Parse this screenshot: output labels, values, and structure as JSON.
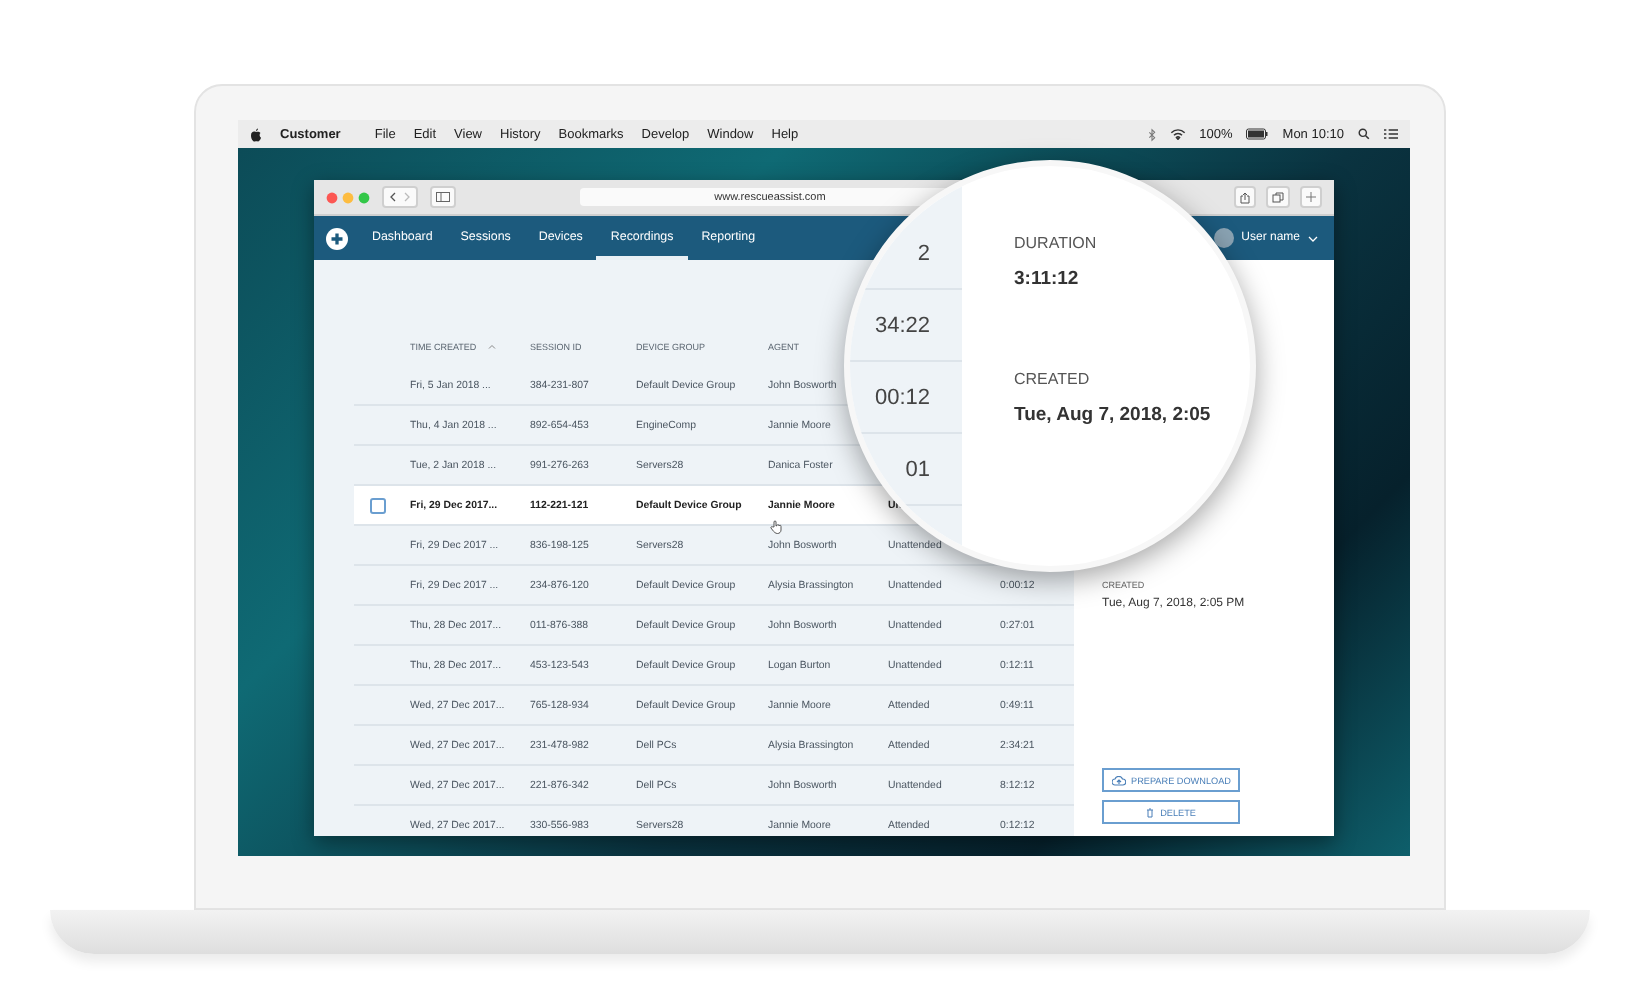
{
  "menubar": {
    "app": "Customer",
    "menus": [
      "File",
      "Edit",
      "View",
      "History",
      "Bookmarks",
      "Develop",
      "Window",
      "Help"
    ],
    "battery": "100%",
    "clock": "Mon 10:10"
  },
  "browser": {
    "url": "www.rescueassist.com"
  },
  "nav": {
    "tabs": [
      {
        "label": "Dashboard",
        "selected": false
      },
      {
        "label": "Sessions",
        "selected": false
      },
      {
        "label": "Devices",
        "selected": false
      },
      {
        "label": "Recordings",
        "selected": true
      },
      {
        "label": "Reporting",
        "selected": false
      }
    ],
    "user": "User name"
  },
  "table": {
    "columns": [
      "TIME CREATED",
      "SESSION ID",
      "DEVICE GROUP",
      "AGENT"
    ],
    "rows": [
      {
        "time": "Fri, 5 Jan 2018 ...",
        "session": "384-231-807",
        "group": "Default Device Group",
        "agent": "John Bosworth",
        "selected": false
      },
      {
        "time": "Thu, 4 Jan 2018 ...",
        "session": "892-654-453",
        "group": "EngineComp",
        "agent": "Jannie Moore",
        "selected": false
      },
      {
        "time": "Tue, 2 Jan 2018 ...",
        "session": "991-276-263",
        "group": "Servers28",
        "agent": "Danica Foster",
        "selected": false
      },
      {
        "time": "Fri, 29 Dec 2017...",
        "session": "112-221-121",
        "group": "Default Device Group",
        "agent": "Jannie Moore",
        "type": "Un",
        "selected": true
      },
      {
        "time": "Fri, 29 Dec 2017 ...",
        "session": "836-198-125",
        "group": "Servers28",
        "agent": "John Bosworth",
        "type": "Unattended",
        "selected": false
      },
      {
        "time": "Fri, 29 Dec 2017 ...",
        "session": "234-876-120",
        "group": "Default Device Group",
        "agent": "Alysia Brassington",
        "type": "Unattended",
        "duration": "0:00:12",
        "selected": false
      },
      {
        "time": "Thu, 28 Dec 2017...",
        "session": "011-876-388",
        "group": "Default Device Group",
        "agent": "John Bosworth",
        "type": "Unattended",
        "duration": "0:27:01",
        "selected": false
      },
      {
        "time": "Thu, 28 Dec 2017...",
        "session": "453-123-543",
        "group": "Default Device Group",
        "agent": "Logan Burton",
        "type": "Unattended",
        "duration": "0:12:11",
        "selected": false
      },
      {
        "time": "Wed, 27 Dec 2017...",
        "session": "765-128-934",
        "group": "Default Device Group",
        "agent": "Jannie Moore",
        "type": "Attended",
        "duration": "0:49:11",
        "selected": false
      },
      {
        "time": "Wed, 27 Dec 2017...",
        "session": "231-478-982",
        "group": "Dell PCs",
        "agent": "Alysia Brassington",
        "type": "Attended",
        "duration": "2:34:21",
        "selected": false
      },
      {
        "time": "Wed, 27 Dec 2017...",
        "session": "221-876-342",
        "group": "Dell PCs",
        "agent": "John Bosworth",
        "type": "Unattended",
        "duration": "8:12:12",
        "selected": false
      },
      {
        "time": "Wed, 27 Dec 2017...",
        "session": "330-556-983",
        "group": "Servers28",
        "agent": "Jannie Moore",
        "type": "Attended",
        "duration": "0:12:12",
        "selected": false
      }
    ]
  },
  "details": {
    "created_label": "CREATED",
    "created_value": "Tue, Aug 7, 2018, 2:05 PM",
    "buttons": [
      {
        "label": "PREPARE DOWNLOAD",
        "kind": "download"
      },
      {
        "label": "DELETE",
        "kind": "delete"
      }
    ]
  },
  "magnifier": {
    "fragments": [
      "2",
      "34:22",
      "00:12",
      "01"
    ],
    "fields": [
      {
        "label": "DURATION",
        "value": "3:11:12"
      },
      {
        "label": "CREATED",
        "value": "Tue, Aug 7, 2018, 2:05"
      }
    ]
  }
}
